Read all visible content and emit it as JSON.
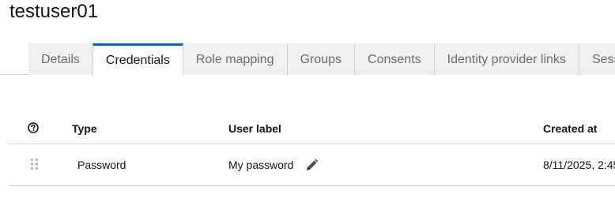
{
  "page": {
    "title": "testuser01"
  },
  "tabs": [
    {
      "label": "Details",
      "active": false
    },
    {
      "label": "Credentials",
      "active": true
    },
    {
      "label": "Role mapping",
      "active": false
    },
    {
      "label": "Groups",
      "active": false
    },
    {
      "label": "Consents",
      "active": false
    },
    {
      "label": "Identity provider links",
      "active": false
    },
    {
      "label": "Sess",
      "active": false
    }
  ],
  "table": {
    "columns": {
      "help_icon": "question-circle-icon",
      "type": "Type",
      "user_label": "User label",
      "created_at": "Created at"
    },
    "rows": [
      {
        "drag_icon": "drag-handle-icon",
        "type": "Password",
        "user_label": "My password",
        "edit_icon": "pencil-icon",
        "created_at": "8/11/2025, 2:45"
      }
    ]
  },
  "colors": {
    "accent": "#0066cc",
    "border": "#d2d2d2",
    "tab_inactive_bg": "#f0f0f0",
    "muted_text": "#6a6e73",
    "text": "#151515"
  }
}
